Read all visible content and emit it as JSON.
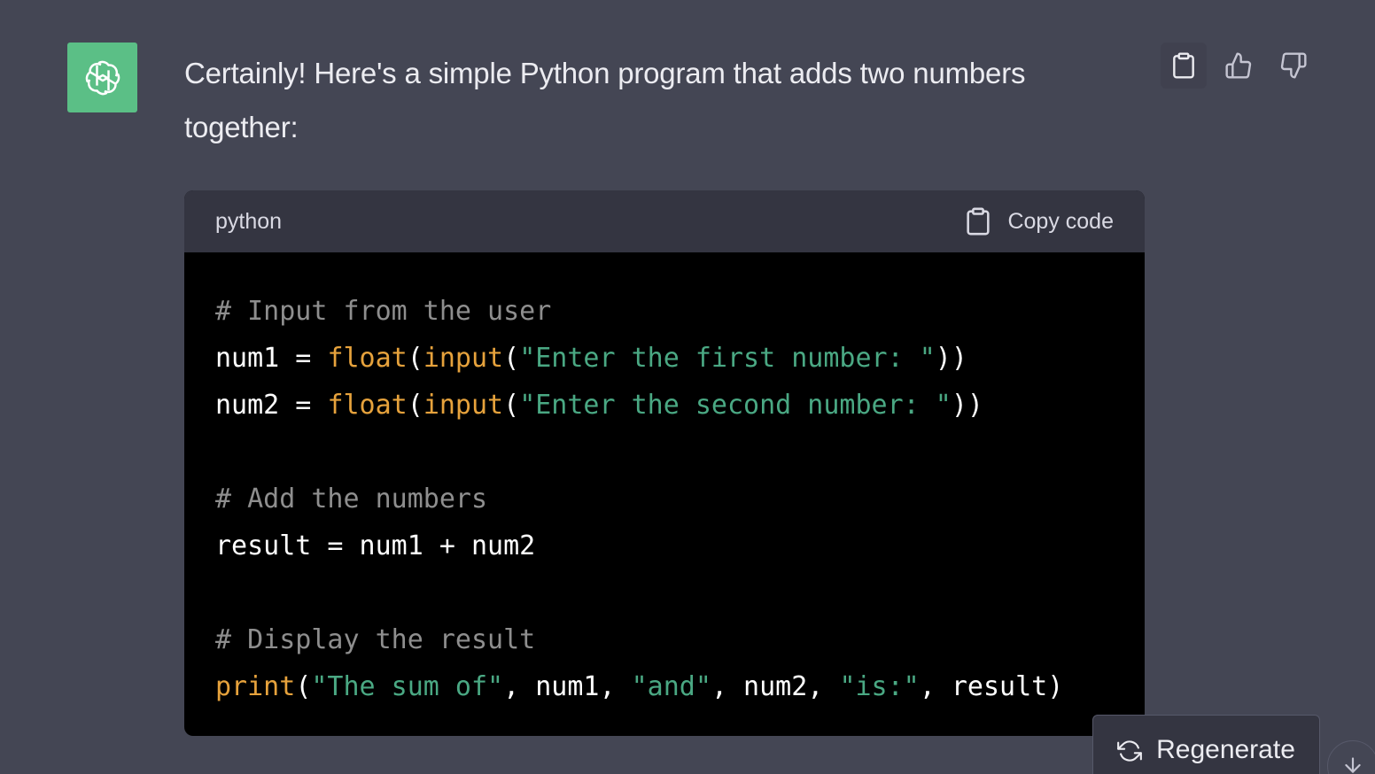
{
  "message": {
    "text": "Certainly! Here's a simple Python program that adds two numbers together:"
  },
  "icons": {
    "avatar": "openai-logo-icon",
    "copy": "clipboard-icon",
    "like": "thumbs-up-icon",
    "dislike": "thumbs-down-icon",
    "regenerate": "refresh-icon",
    "scroll": "arrow-down-icon"
  },
  "code": {
    "language": "python",
    "copy_label": "Copy code",
    "lines": [
      [
        {
          "t": "# Input from the user",
          "k": "comment"
        }
      ],
      [
        {
          "t": "num1 = ",
          "k": "plain"
        },
        {
          "t": "float",
          "k": "builtin"
        },
        {
          "t": "(",
          "k": "plain"
        },
        {
          "t": "input",
          "k": "builtin"
        },
        {
          "t": "(",
          "k": "plain"
        },
        {
          "t": "\"Enter the first number: \"",
          "k": "string"
        },
        {
          "t": "))",
          "k": "plain"
        }
      ],
      [
        {
          "t": "num2 = ",
          "k": "plain"
        },
        {
          "t": "float",
          "k": "builtin"
        },
        {
          "t": "(",
          "k": "plain"
        },
        {
          "t": "input",
          "k": "builtin"
        },
        {
          "t": "(",
          "k": "plain"
        },
        {
          "t": "\"Enter the second number: \"",
          "k": "string"
        },
        {
          "t": "))",
          "k": "plain"
        }
      ],
      [],
      [
        {
          "t": "# Add the numbers",
          "k": "comment"
        }
      ],
      [
        {
          "t": "result = num1 + num2",
          "k": "plain"
        }
      ],
      [],
      [
        {
          "t": "# Display the result",
          "k": "comment"
        }
      ],
      [
        {
          "t": "print",
          "k": "builtin"
        },
        {
          "t": "(",
          "k": "plain"
        },
        {
          "t": "\"The sum of\"",
          "k": "string"
        },
        {
          "t": ", num1, ",
          "k": "plain"
        },
        {
          "t": "\"and\"",
          "k": "string"
        },
        {
          "t": ", num2, ",
          "k": "plain"
        },
        {
          "t": "\"is:\"",
          "k": "string"
        },
        {
          "t": ", result)",
          "k": "plain"
        }
      ]
    ]
  },
  "buttons": {
    "regenerate_label": "Regenerate"
  },
  "colors": {
    "background": "#444654",
    "avatar": "#5bbf86",
    "code_header": "#343541",
    "code_body": "#000000",
    "comment": "#8e8e8e",
    "builtin": "#e6a23c",
    "string": "#4aa883"
  }
}
